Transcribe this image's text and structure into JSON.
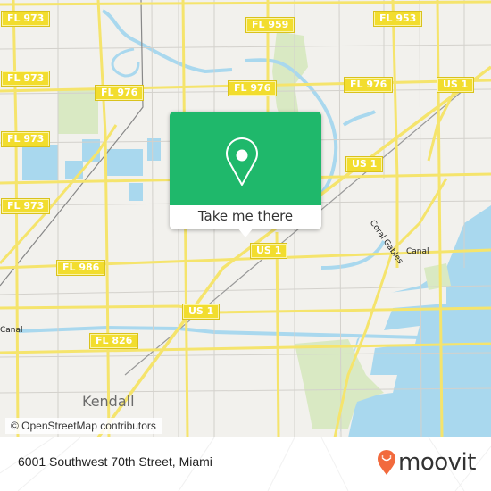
{
  "map": {
    "road_shields": [
      {
        "label": "FL 973"
      },
      {
        "label": "FL 973"
      },
      {
        "label": "FL 973"
      },
      {
        "label": "FL 973"
      },
      {
        "label": "FL 959"
      },
      {
        "label": "FL 953"
      },
      {
        "label": "FL 976"
      },
      {
        "label": "FL 976"
      },
      {
        "label": "FL 976"
      },
      {
        "label": "US 1"
      },
      {
        "label": "US 1"
      },
      {
        "label": "US 1"
      },
      {
        "label": "US 1"
      },
      {
        "label": "FL 986"
      },
      {
        "label": "FL 826"
      }
    ],
    "place_labels": {
      "kendall": "Kendall"
    },
    "water_labels": {
      "coral_gables_canal_a": "Coral Gables",
      "coral_gables_canal_b": "Canal",
      "canal_west": "Canal"
    },
    "attribution": "© OpenStreetMap contributors",
    "colors": {
      "land": "#f2f1ed",
      "water": "#a9d8ee",
      "park": "#d9e9c3",
      "major_road": "#f5e46c",
      "minor_road": "#d3d1cc",
      "shield": "#f2dd2e"
    }
  },
  "popup": {
    "icon": "map-pin-icon",
    "action_label": "Take me there",
    "accent": "#1fb86b"
  },
  "footer": {
    "address": "6001 Southwest 70th Street, Miami",
    "brand": "moovit",
    "brand_color": "#f26a3d"
  }
}
